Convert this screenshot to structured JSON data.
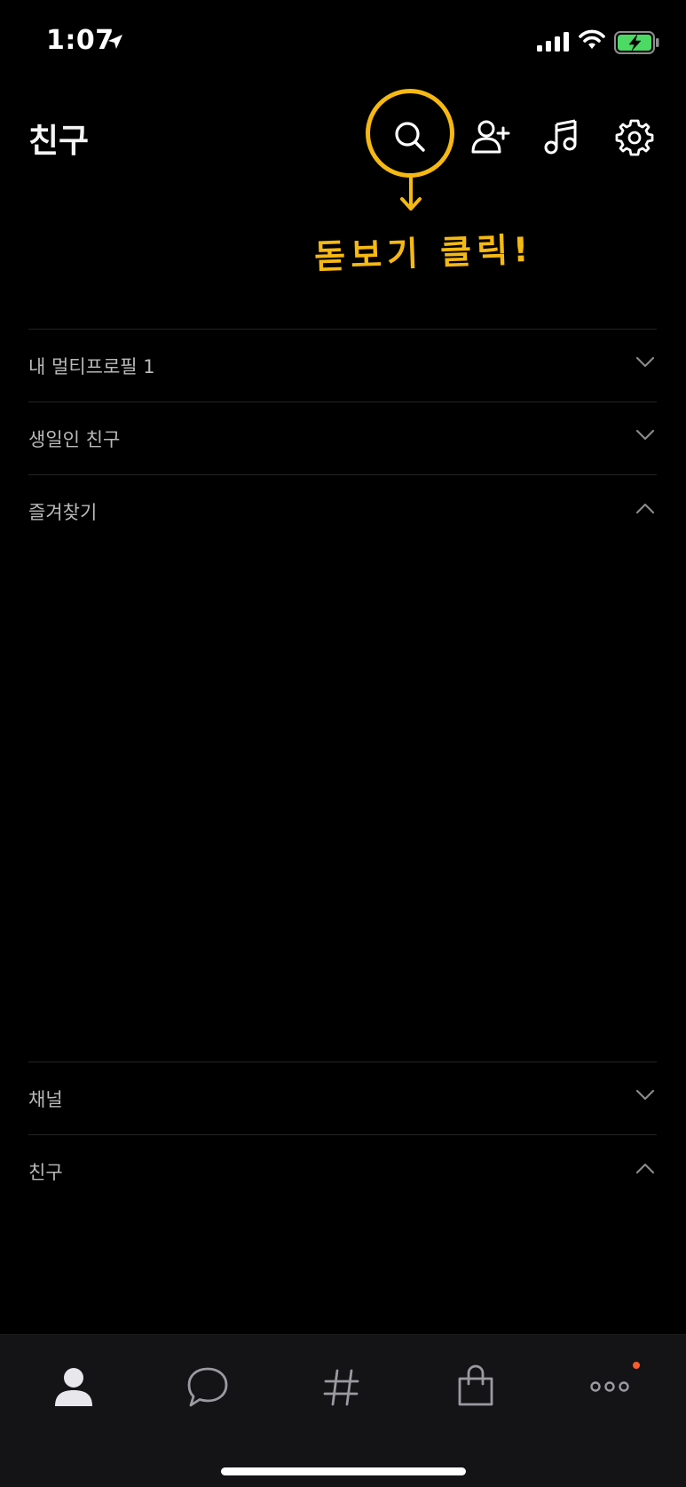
{
  "status_bar": {
    "time": "1:07"
  },
  "header": {
    "title": "친구",
    "icons": [
      "search-icon",
      "add-friend-icon",
      "music-icon",
      "gear-icon"
    ]
  },
  "annotation": {
    "text": "돋보기 클릭!",
    "color": "#f6b912"
  },
  "sections": [
    {
      "label": "내 멀티프로필 1",
      "state": "collapsed"
    },
    {
      "label": "생일인 친구",
      "state": "collapsed"
    },
    {
      "label": "즐겨찾기",
      "state": "expanded"
    },
    {
      "label": "채널",
      "state": "collapsed"
    },
    {
      "label": "친구",
      "state": "expanded"
    }
  ],
  "tabs": [
    {
      "icon": "person-icon",
      "active": true
    },
    {
      "icon": "chat-bubble-icon",
      "active": false
    },
    {
      "icon": "hashtag-icon",
      "active": false
    },
    {
      "icon": "shopping-bag-icon",
      "active": false
    },
    {
      "icon": "more-dots-icon",
      "active": false,
      "badge": "dot"
    }
  ],
  "colors": {
    "background": "#000000",
    "tab_bar": "#141416",
    "accent_annotation": "#f6b912",
    "badge": "#ff5a2b"
  }
}
